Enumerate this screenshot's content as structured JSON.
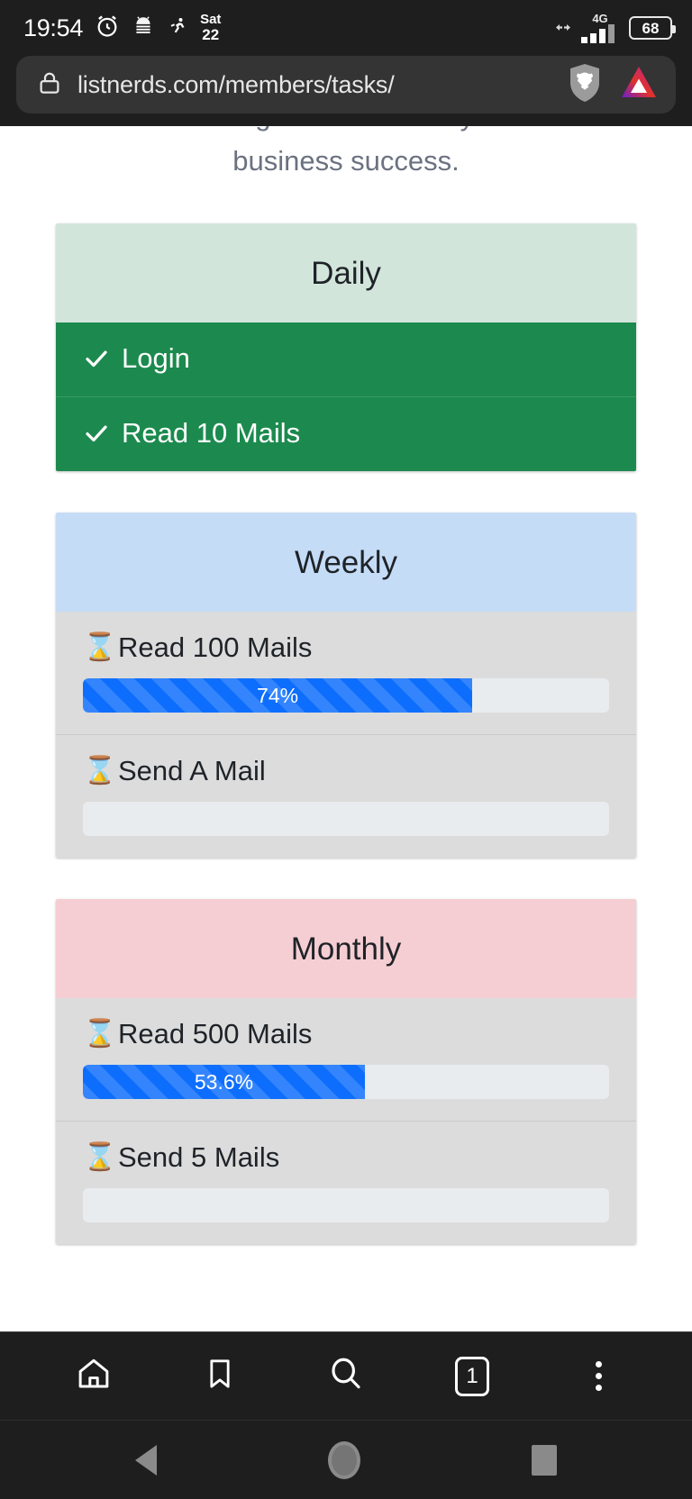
{
  "status_bar": {
    "time": "19:54",
    "date_day": "Sat",
    "date_num": "22",
    "network_type": "4G",
    "battery_percent": "68",
    "icons": [
      "alarm-icon",
      "android-debug-icon",
      "running-icon",
      "date-icon",
      "mobile-data-icon",
      "signal-icon",
      "battery-icon"
    ]
  },
  "browser": {
    "url": "listnerds.com/members/tasks/",
    "lock_icon": "lock-icon",
    "brave_shield_icon": "brave-shields-icon",
    "bat_rewards_icon": "brave-rewards-triangle-icon",
    "toolbar": {
      "home_label": "Home",
      "bookmarks_label": "Bookmarks",
      "search_label": "Search",
      "tab_count": "1",
      "menu_label": "Menu"
    }
  },
  "page": {
    "intro_line_1": "earnings and increase your",
    "intro_line_2": "business success.",
    "cards": [
      {
        "title": "Daily",
        "state": "done",
        "tasks": [
          {
            "label": "Login",
            "icon": "check-icon",
            "complete": true
          },
          {
            "label": "Read 10 Mails",
            "icon": "check-icon",
            "complete": true
          }
        ]
      },
      {
        "title": "Weekly",
        "state": "pending",
        "tasks": [
          {
            "label": "Read 100 Mails",
            "icon": "hourglass-icon",
            "complete": false,
            "progress_label": "74%",
            "progress_value": 74
          },
          {
            "label": "Send A Mail",
            "icon": "hourglass-icon",
            "complete": false,
            "progress_label": "",
            "progress_value": 0
          }
        ]
      },
      {
        "title": "Monthly",
        "state": "pending",
        "tasks": [
          {
            "label": "Read 500 Mails",
            "icon": "hourglass-icon",
            "complete": false,
            "progress_label": "53.6%",
            "progress_value": 53.6
          },
          {
            "label": "Send 5 Mails",
            "icon": "hourglass-icon",
            "complete": false,
            "progress_label": "",
            "progress_value": 0
          }
        ]
      }
    ]
  },
  "android_nav": {
    "back_label": "Back",
    "home_label": "Home",
    "recents_label": "Recents"
  },
  "colors": {
    "daily_header": "#d2e5db",
    "daily_body": "#1c8a4e",
    "weekly_header": "#c5dcf7",
    "monthly_header": "#f5ced3",
    "pending_body": "#dcdcdc",
    "progress_fill": "#0d6efd",
    "progress_track": "#e9ecef",
    "chrome_dark": "#1e1e1e"
  }
}
